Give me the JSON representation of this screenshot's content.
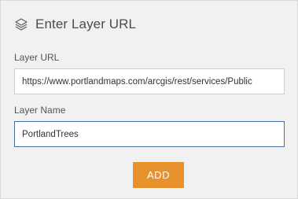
{
  "panel": {
    "title": "Enter Layer URL",
    "title_icon": "layers-icon"
  },
  "layer_url": {
    "label": "Layer URL",
    "value": "https://www.portlandmaps.com/arcgis/rest/services/Public"
  },
  "layer_name": {
    "label": "Layer Name",
    "value": "PortlandTrees"
  },
  "add_button": {
    "label": "ADD",
    "color": "#e8922e"
  }
}
